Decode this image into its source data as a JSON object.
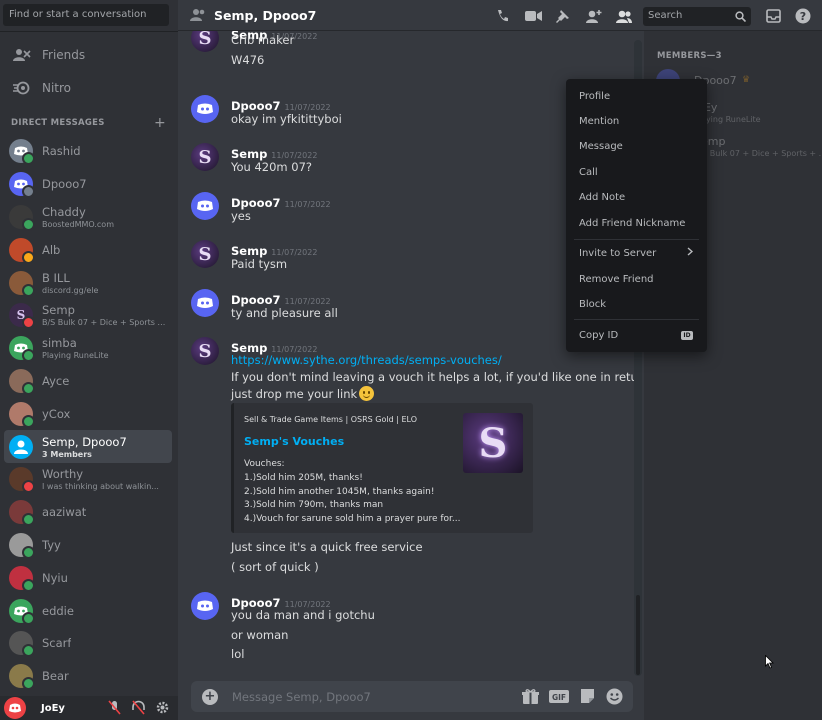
{
  "sidebar": {
    "search_placeholder": "Find or start a conversation",
    "nav": [
      {
        "label": "Friends",
        "icon": "friends-icon"
      },
      {
        "label": "Nitro",
        "icon": "nitro-icon"
      }
    ],
    "dm_header": "DIRECT MESSAGES",
    "dm_add_icon": "plus-icon",
    "dms": [
      {
        "name": "Rashid",
        "sub": "",
        "color": "#747f8d",
        "status": "#3ba55d"
      },
      {
        "name": "Dpooo7",
        "sub": "",
        "color": "#5865f2",
        "status": "#747f8d"
      },
      {
        "name": "Chaddy",
        "sub": "BoostedMMO.com",
        "color": "#3a3a3a",
        "status": "#3ba55d"
      },
      {
        "name": "Alb",
        "sub": "",
        "color": "#c04a2a",
        "status": "#faa81a"
      },
      {
        "name": "B ILL",
        "sub": "discord.gg/ele",
        "color": "#8a5a3a",
        "status": "#3ba55d"
      },
      {
        "name": "Semp",
        "sub": "B/S Bulk 07 + Dice + Sports + ...",
        "color": "#3b2a4a",
        "status": "#ed4245"
      },
      {
        "name": "simba",
        "sub": "Playing RuneLite",
        "color": "#3ba55d",
        "status": "#3ba55d"
      },
      {
        "name": "Ayce",
        "sub": "",
        "color": "#8a6a5a",
        "status": "#3ba55d"
      },
      {
        "name": "yCox",
        "sub": "",
        "color": "#b07a6a",
        "status": "#3ba55d"
      },
      {
        "name": "Semp, Dpooo7",
        "sub": "3 Members",
        "color": "#00aff4",
        "status": ""
      },
      {
        "name": "Worthy",
        "sub": "I was thinking about walkin...",
        "color": "#5a3a2a",
        "status": "#ed4245"
      },
      {
        "name": "aaziwat",
        "sub": "",
        "color": "#7a3a3a",
        "status": "#3ba55d"
      },
      {
        "name": "Tyy",
        "sub": "",
        "color": "#9a9a9a",
        "status": "#3ba55d"
      },
      {
        "name": "Nyiu",
        "sub": "",
        "color": "#c03040",
        "status": "#3ba55d"
      },
      {
        "name": "eddie",
        "sub": "",
        "color": "#3ba55d",
        "status": "#3ba55d"
      },
      {
        "name": "Scarf",
        "sub": "",
        "color": "#555555",
        "status": "#3ba55d"
      },
      {
        "name": "Bear",
        "sub": "",
        "color": "#8a7a4a",
        "status": "#3ba55d"
      }
    ],
    "user": {
      "name": "JoEy"
    }
  },
  "header": {
    "title": "Semp, Dpooo7",
    "search_placeholder": "Search",
    "icons": [
      "call-icon",
      "video-icon",
      "pin-icon",
      "add-member-icon",
      "members-icon",
      "inbox-icon",
      "help-icon"
    ]
  },
  "messages": [
    {
      "author": "Semp",
      "time": "11/07/2022",
      "lines": [
        "Crib maker",
        "W476"
      ],
      "avatar": "semp"
    },
    {
      "author": "Dpooo7",
      "time": "11/07/2022",
      "lines": [
        "okay im yfkitittyboi"
      ],
      "avatar": "discord"
    },
    {
      "author": "Semp",
      "time": "11/07/2022",
      "lines": [
        "You 420m 07?"
      ],
      "avatar": "semp"
    },
    {
      "author": "Dpooo7",
      "time": "11/07/2022",
      "lines": [
        "yes"
      ],
      "avatar": "discord"
    },
    {
      "author": "Semp",
      "time": "11/07/2022",
      "lines": [
        "Paid tysm"
      ],
      "avatar": "semp"
    },
    {
      "author": "Dpooo7",
      "time": "11/07/2022",
      "lines": [
        "ty and pleasure all"
      ],
      "avatar": "discord"
    },
    {
      "author": "Semp",
      "time": "11/07/2022",
      "link": "https://www.sythe.org/threads/semps-vouches/",
      "lines": [
        "If you don't mind leaving a vouch it helps a lot, if you'd like one in return",
        "just drop me your link"
      ],
      "avatar": "semp"
    },
    {
      "author": "Dpooo7",
      "time": "11/07/2022",
      "lines": [
        "you da man and i gotchu",
        "or woman",
        "lol"
      ],
      "avatar": "discord"
    }
  ],
  "after_embed": [
    "Just since it's a quick free service",
    "( sort of quick )"
  ],
  "embed": {
    "provider": "Sell & Trade Game Items | OSRS Gold | ELO",
    "title": "Semp's Vouches",
    "heading": "Vouches:",
    "lines": [
      "1.)Sold him 205M, thanks!",
      "2.)Sold him another 1045M, thanks again!",
      "3.)Sold him 790m, thanks man",
      "4.)Vouch for sarune sold him a prayer pure for..."
    ],
    "thumb_letter": "S"
  },
  "composer": {
    "placeholder": "Message Semp, Dpooo7",
    "icons": [
      "gift-icon",
      "gif-icon",
      "sticker-icon",
      "emoji-icon"
    ]
  },
  "members_panel": {
    "heading": "MEMBERS—3",
    "members": [
      {
        "name": "Dpooo7",
        "sub": ""
      },
      {
        "name": "JoEy",
        "sub": "Playing RuneLite"
      },
      {
        "name": "Semp",
        "sub": "B/S Bulk 07 + Dice + Sports + ..."
      }
    ]
  },
  "context_menu": {
    "items": [
      "Profile",
      "Mention",
      "Message",
      "Call",
      "Add Note",
      "Add Friend Nickname",
      "Invite to Server",
      "Remove Friend",
      "Block",
      "Copy ID"
    ],
    "id_badge": "ID"
  },
  "colors": {
    "blurple": "#5865f2",
    "link": "#00aff4",
    "background": "#36393f",
    "sidebar": "#2f3136"
  }
}
